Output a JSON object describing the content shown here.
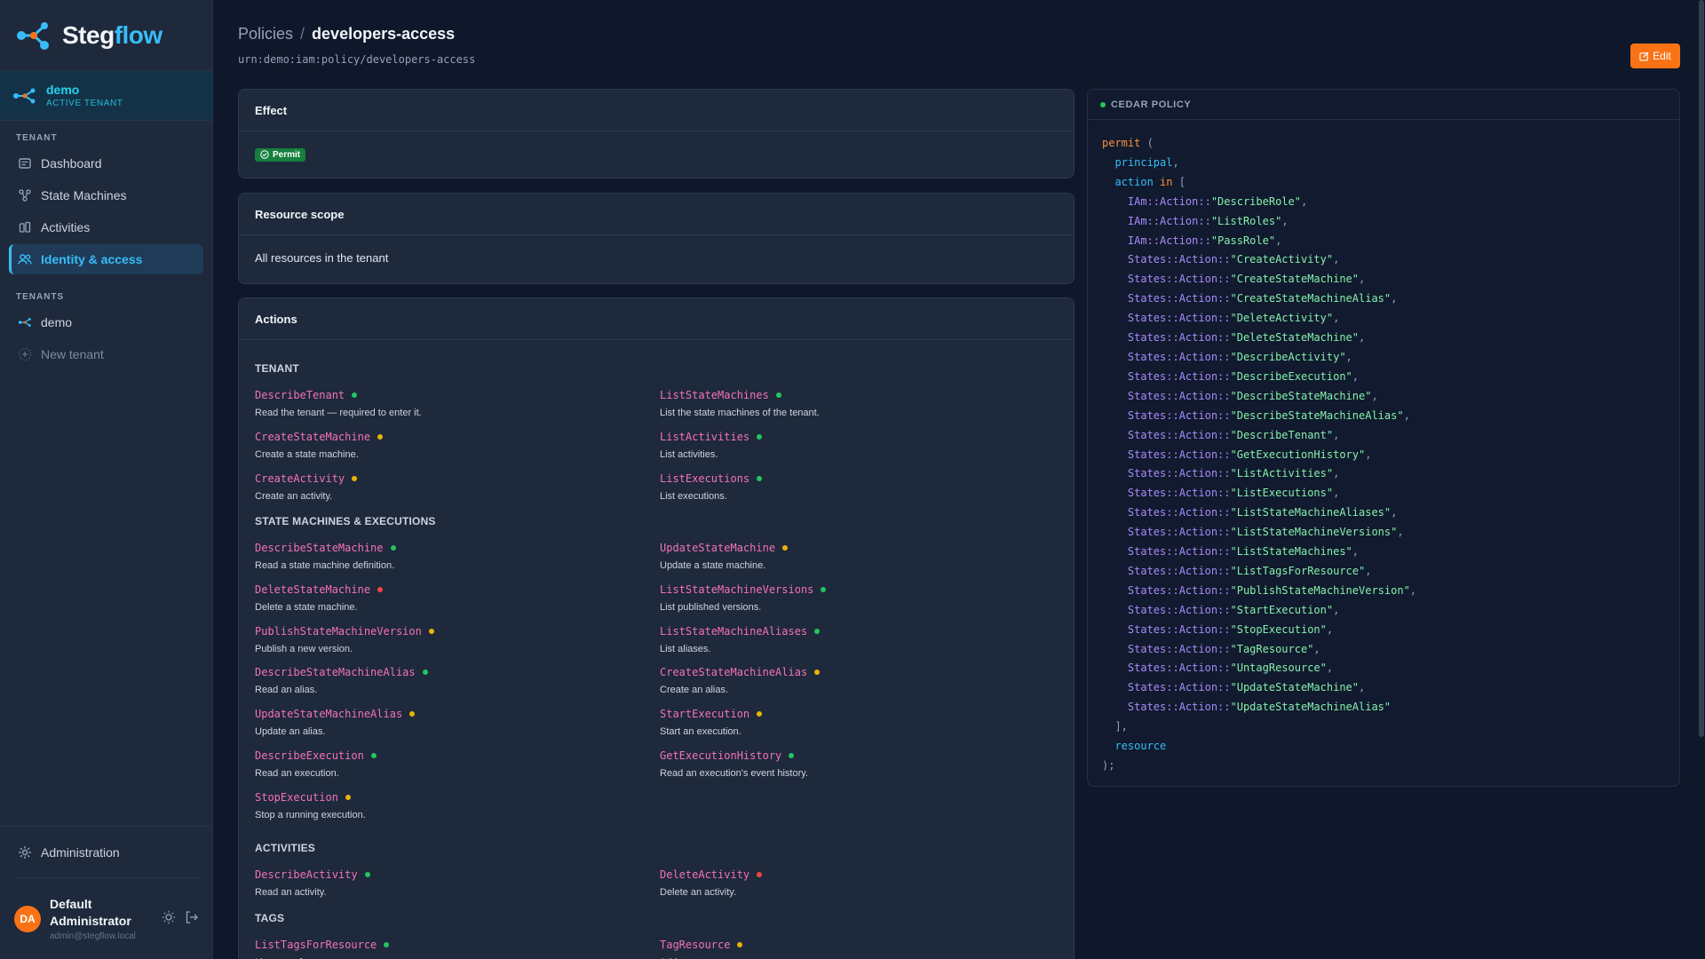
{
  "brand": {
    "name_a": "Steg",
    "name_b": "flow"
  },
  "active_tenant": {
    "name": "demo",
    "label": "ACTIVE TENANT"
  },
  "sidebar": {
    "tenant_section": "TENANT",
    "items": [
      {
        "label": "Dashboard",
        "icon": "dashboard-icon"
      },
      {
        "label": "State Machines",
        "icon": "state-machine-icon"
      },
      {
        "label": "Activities",
        "icon": "activities-icon"
      },
      {
        "label": "Identity & access",
        "icon": "users-icon",
        "active": true
      }
    ],
    "tenants_section": "TENANTS",
    "tenants": [
      {
        "label": "demo"
      }
    ],
    "new_tenant": "New tenant",
    "administration": "Administration",
    "user": {
      "initials": "DA",
      "name": "Default Administrator",
      "email": "admin@stegflow.local"
    }
  },
  "breadcrumb": {
    "parent": "Policies",
    "separator": "/",
    "current": "developers-access"
  },
  "urn": "urn:demo:iam:policy/developers-access",
  "edit_label": "Edit",
  "effect": {
    "title": "Effect",
    "value": "Permit"
  },
  "resource_scope": {
    "title": "Resource scope",
    "value": "All resources in the tenant"
  },
  "actions": {
    "title": "Actions",
    "groups": [
      {
        "label": "TENANT",
        "items": [
          {
            "name": "DescribeTenant",
            "desc": "Read the tenant — required to enter it.",
            "level": "read"
          },
          {
            "name": "ListStateMachines",
            "desc": "List the state machines of the tenant.",
            "level": "read"
          },
          {
            "name": "CreateStateMachine",
            "desc": "Create a state machine.",
            "level": "write"
          },
          {
            "name": "ListActivities",
            "desc": "List activities.",
            "level": "read"
          },
          {
            "name": "CreateActivity",
            "desc": "Create an activity.",
            "level": "write"
          },
          {
            "name": "ListExecutions",
            "desc": "List executions.",
            "level": "read"
          }
        ]
      },
      {
        "label": "STATE MACHINES & EXECUTIONS",
        "items": [
          {
            "name": "DescribeStateMachine",
            "desc": "Read a state machine definition.",
            "level": "read"
          },
          {
            "name": "UpdateStateMachine",
            "desc": "Update a state machine.",
            "level": "write"
          },
          {
            "name": "DeleteStateMachine",
            "desc": "Delete a state machine.",
            "level": "delete"
          },
          {
            "name": "ListStateMachineVersions",
            "desc": "List published versions.",
            "level": "read"
          },
          {
            "name": "PublishStateMachineVersion",
            "desc": "Publish a new version.",
            "level": "write"
          },
          {
            "name": "ListStateMachineAliases",
            "desc": "List aliases.",
            "level": "read"
          },
          {
            "name": "DescribeStateMachineAlias",
            "desc": "Read an alias.",
            "level": "read"
          },
          {
            "name": "CreateStateMachineAlias",
            "desc": "Create an alias.",
            "level": "write"
          },
          {
            "name": "UpdateStateMachineAlias",
            "desc": "Update an alias.",
            "level": "write"
          },
          {
            "name": "StartExecution",
            "desc": "Start an execution.",
            "level": "write"
          },
          {
            "name": "DescribeExecution",
            "desc": "Read an execution.",
            "level": "read"
          },
          {
            "name": "GetExecutionHistory",
            "desc": "Read an execution's event history.",
            "level": "read"
          },
          {
            "name": "StopExecution",
            "desc": "Stop a running execution.",
            "level": "write"
          }
        ]
      },
      {
        "label": "ACTIVITIES",
        "items": [
          {
            "name": "DescribeActivity",
            "desc": "Read an activity.",
            "level": "read"
          },
          {
            "name": "DeleteActivity",
            "desc": "Delete an activity.",
            "level": "delete"
          }
        ]
      },
      {
        "label": "TAGS",
        "items": [
          {
            "name": "ListTagsForResource",
            "desc": "List tags of a resource.",
            "level": "read"
          },
          {
            "name": "TagResource",
            "desc": "Add tags to a resource.",
            "level": "write"
          }
        ]
      }
    ]
  },
  "level_colors": {
    "read": "#22c55e",
    "write": "#eab308",
    "delete": "#ef4444"
  },
  "cedar": {
    "title": "CEDAR POLICY",
    "keyword": "permit",
    "principal": "principal",
    "action_kw": "action",
    "in_kw": "in",
    "resource": "resource",
    "actions": [
      [
        "IAm::Action::",
        "\"DescribeRole\""
      ],
      [
        "IAm::Action::",
        "\"ListRoles\""
      ],
      [
        "IAm::Action::",
        "\"PassRole\""
      ],
      [
        "States::Action::",
        "\"CreateActivity\""
      ],
      [
        "States::Action::",
        "\"CreateStateMachine\""
      ],
      [
        "States::Action::",
        "\"CreateStateMachineAlias\""
      ],
      [
        "States::Action::",
        "\"DeleteActivity\""
      ],
      [
        "States::Action::",
        "\"DeleteStateMachine\""
      ],
      [
        "States::Action::",
        "\"DescribeActivity\""
      ],
      [
        "States::Action::",
        "\"DescribeExecution\""
      ],
      [
        "States::Action::",
        "\"DescribeStateMachine\""
      ],
      [
        "States::Action::",
        "\"DescribeStateMachineAlias\""
      ],
      [
        "States::Action::",
        "\"DescribeTenant\""
      ],
      [
        "States::Action::",
        "\"GetExecutionHistory\""
      ],
      [
        "States::Action::",
        "\"ListActivities\""
      ],
      [
        "States::Action::",
        "\"ListExecutions\""
      ],
      [
        "States::Action::",
        "\"ListStateMachineAliases\""
      ],
      [
        "States::Action::",
        "\"ListStateMachineVersions\""
      ],
      [
        "States::Action::",
        "\"ListStateMachines\""
      ],
      [
        "States::Action::",
        "\"ListTagsForResource\""
      ],
      [
        "States::Action::",
        "\"PublishStateMachineVersion\""
      ],
      [
        "States::Action::",
        "\"StartExecution\""
      ],
      [
        "States::Action::",
        "\"StopExecution\""
      ],
      [
        "States::Action::",
        "\"TagResource\""
      ],
      [
        "States::Action::",
        "\"UntagResource\""
      ],
      [
        "States::Action::",
        "\"UpdateStateMachine\""
      ],
      [
        "States::Action::",
        "\"UpdateStateMachineAlias\""
      ]
    ]
  }
}
